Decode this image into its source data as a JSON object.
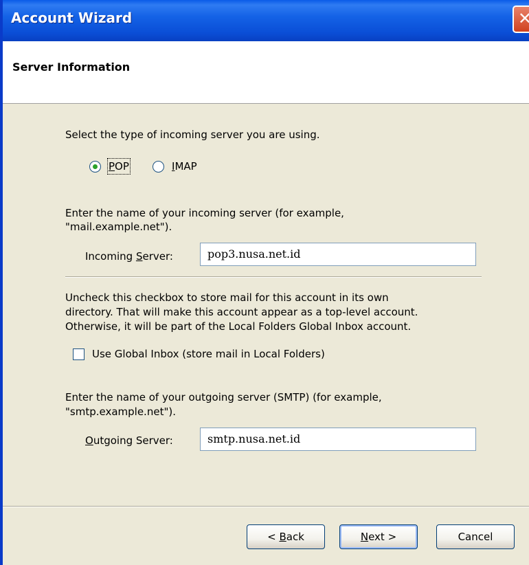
{
  "window": {
    "title": "Account Wizard",
    "close_glyph": "✕"
  },
  "header": {
    "title": "Server Information"
  },
  "server_type": {
    "prompt": "Select the type of incoming server you are using.",
    "options": [
      {
        "label_u": "P",
        "label_rest": "OP",
        "selected": true
      },
      {
        "label_u": "I",
        "label_rest": "MAP",
        "selected": false
      }
    ]
  },
  "incoming": {
    "prompt_line1": "Enter the name of your incoming server (for example,",
    "prompt_line2": "\"mail.example.net\").",
    "label_pre": "Incoming ",
    "label_u": "S",
    "label_post": "erver:",
    "value": "pop3.nusa.net.id"
  },
  "global_inbox": {
    "text_line1": "Uncheck this checkbox to store mail for this account in its own",
    "text_line2": "directory. That will make this account appear as a top-level account.",
    "text_line3": "Otherwise, it will be part of the Local Folders Global Inbox account.",
    "checkbox_label": "Use Global Inbox (store mail in Local Folders)",
    "checked": false
  },
  "outgoing": {
    "prompt_line1": "Enter the name of your outgoing server (SMTP) (for example,",
    "prompt_line2": "\"smtp.example.net\").",
    "label_u": "O",
    "label_post": "utgoing Server:",
    "value": "smtp.nusa.net.id"
  },
  "buttons": {
    "back_pre": "< ",
    "back_u": "B",
    "back_post": "ack",
    "next_u": "N",
    "next_post": "ext >",
    "cancel": "Cancel"
  }
}
